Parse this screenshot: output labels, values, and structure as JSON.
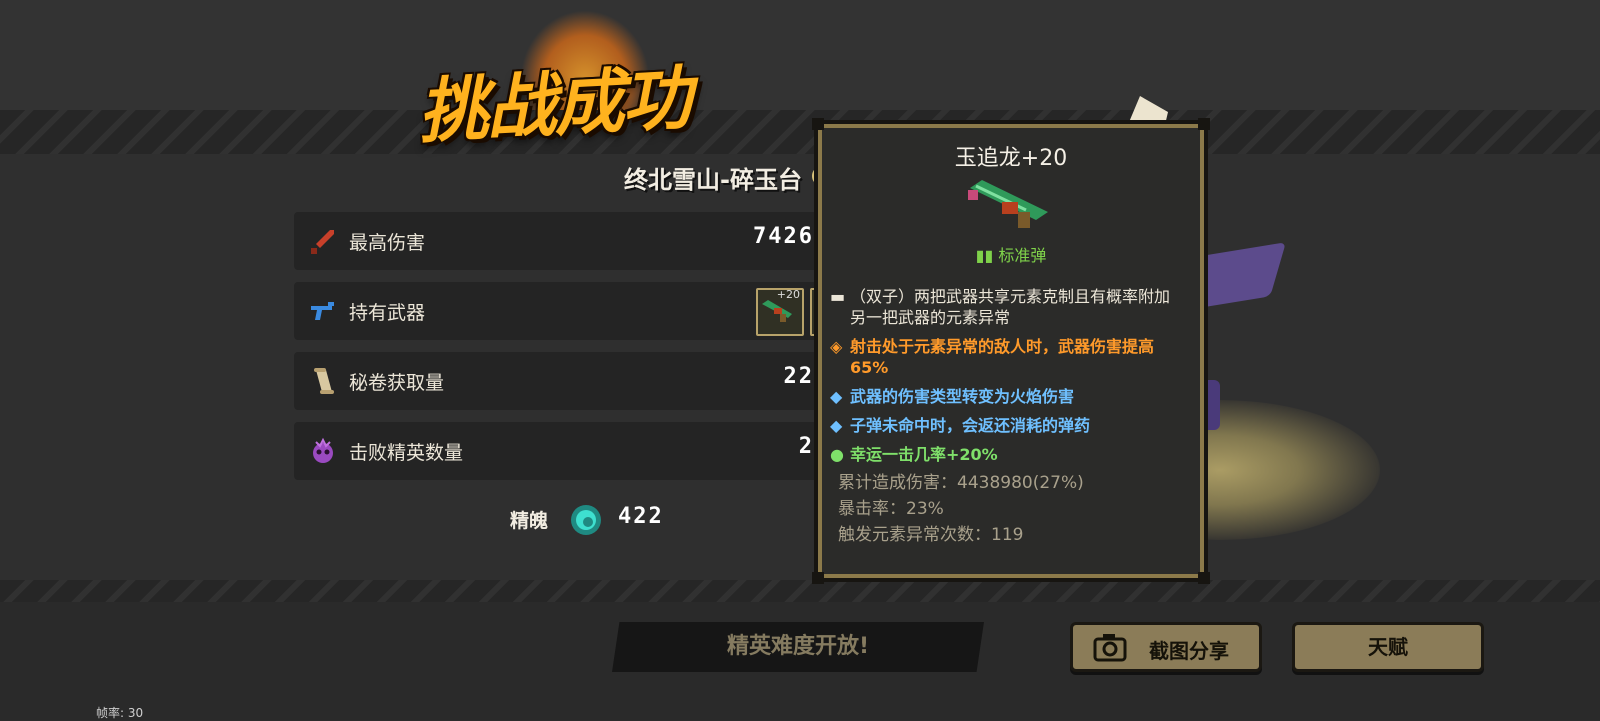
{
  "header": {
    "title": "挑战成功",
    "location": "终北雪山-碎玉台"
  },
  "stats": [
    {
      "label": "最高伤害",
      "value": "7426",
      "icon": "sword-icon"
    },
    {
      "label": "持有武器",
      "value": "",
      "icon": "gun-icon"
    },
    {
      "label": "秘卷获取量",
      "value": "22",
      "icon": "scroll-icon"
    },
    {
      "label": "击败精英数量",
      "value": "2",
      "icon": "elite-skull-icon"
    }
  ],
  "weapons": [
    {
      "level": "+20",
      "icon": "jade-dragon-gun-icon"
    }
  ],
  "soul": {
    "label": "精魄",
    "value": "422",
    "icon": "soul-gem-icon"
  },
  "tooltip": {
    "name": "玉追龙+20",
    "ammo": "标准弹",
    "lines": [
      {
        "marker": "▬",
        "text": "（双子）两把武器共享元素克制且有概率附加另一把武器的元素异常",
        "color": "white"
      },
      {
        "marker": "◈",
        "text": "射击处于元素异常的敌人时，武器伤害提高65%",
        "color": "orange"
      },
      {
        "marker": "◆",
        "text": "武器的伤害类型转变为火焰伤害",
        "color": "blue"
      },
      {
        "marker": "◆",
        "text": "子弹未命中时，会返还消耗的弹药",
        "color": "blue"
      },
      {
        "marker": "●",
        "text": "幸运一击几率+20%",
        "color": "green"
      }
    ],
    "stats": [
      "累计造成伤害：4438980(27%)",
      "暴击率：23%",
      "触发元素异常次数：119"
    ]
  },
  "banner": "精英难度开放!",
  "buttons": {
    "share": "截图分享",
    "talent": "天赋"
  },
  "fps_label": "帧率: 30",
  "colors": {
    "title": "#ffb21e",
    "accent_gold": "#8c7a4a",
    "orange_text": "#ff9a2a",
    "blue_text": "#6fc0ff",
    "green_text": "#7fe06a"
  }
}
